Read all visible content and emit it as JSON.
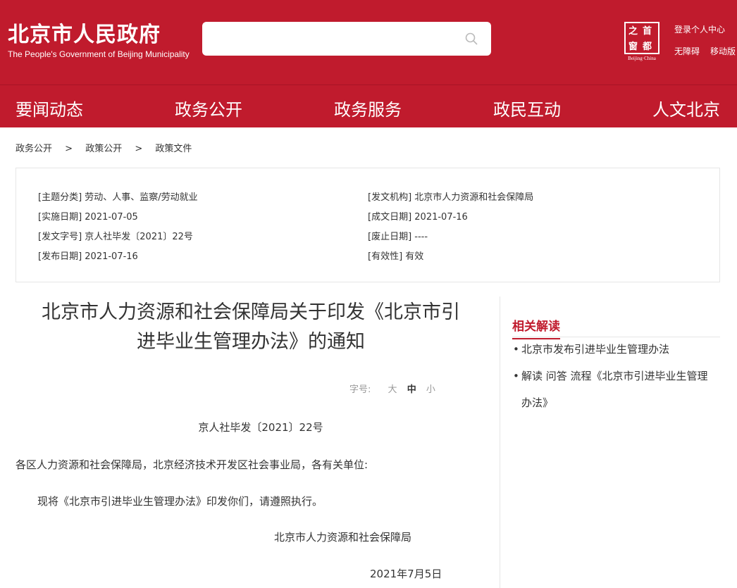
{
  "header": {
    "logo_cn": "北京市人民政府",
    "logo_en": "The People's Government of Beijing Municipality",
    "search_placeholder": "",
    "capital_chars": [
      "首",
      "都",
      "之",
      "窗"
    ],
    "capital_en": "Beijing·China",
    "links": {
      "login": "登录个人中心",
      "accessibility": "无障碍",
      "mobile": "移动版"
    }
  },
  "nav": [
    "要闻动态",
    "政务公开",
    "政务服务",
    "政民互动",
    "人文北京"
  ],
  "breadcrumb": [
    "政务公开",
    ">",
    "政策公开",
    ">",
    "政策文件"
  ],
  "info": {
    "topic": "[主题分类] 劳动、人事、监察/劳动就业",
    "issuer": "[发文机构] 北京市人力资源和社会保障局",
    "effective": "[实施日期] 2021-07-05",
    "written": "[成文日期] 2021-07-16",
    "doc_no": "[发文字号] 京人社毕发〔2021〕22号",
    "repeal": "[废止日期] ----",
    "published": "[发布日期] 2021-07-16",
    "validity": "[有效性] 有效"
  },
  "article": {
    "title_line1": "北京市人力资源和社会保障局关于印发《北京市引",
    "title_line2": "进毕业生管理办法》的通知",
    "fontsize_label": "字号:",
    "fontsize_options": [
      "大",
      "中",
      "小"
    ],
    "doc_no": "京人社毕发〔2021〕22号",
    "salutation": "各区人力资源和社会保障局，北京经济技术开发区社会事业局，各有关单位:",
    "body": "现将《北京市引进毕业生管理办法》印发你们，请遵照执行。",
    "signature": "北京市人力资源和社会保障局",
    "date": "2021年7月5日"
  },
  "sidebar": {
    "title": "相关解读",
    "items": [
      {
        "bullet": "•",
        "text": "北京市发布引进毕业生管理办法"
      },
      {
        "bullet": "•",
        "text": "解读 问答 流程《北京市引进毕业生管理"
      },
      {
        "bullet": "",
        "text": "办法》"
      }
    ]
  },
  "colors": {
    "brand_red": "#c01b2d"
  }
}
